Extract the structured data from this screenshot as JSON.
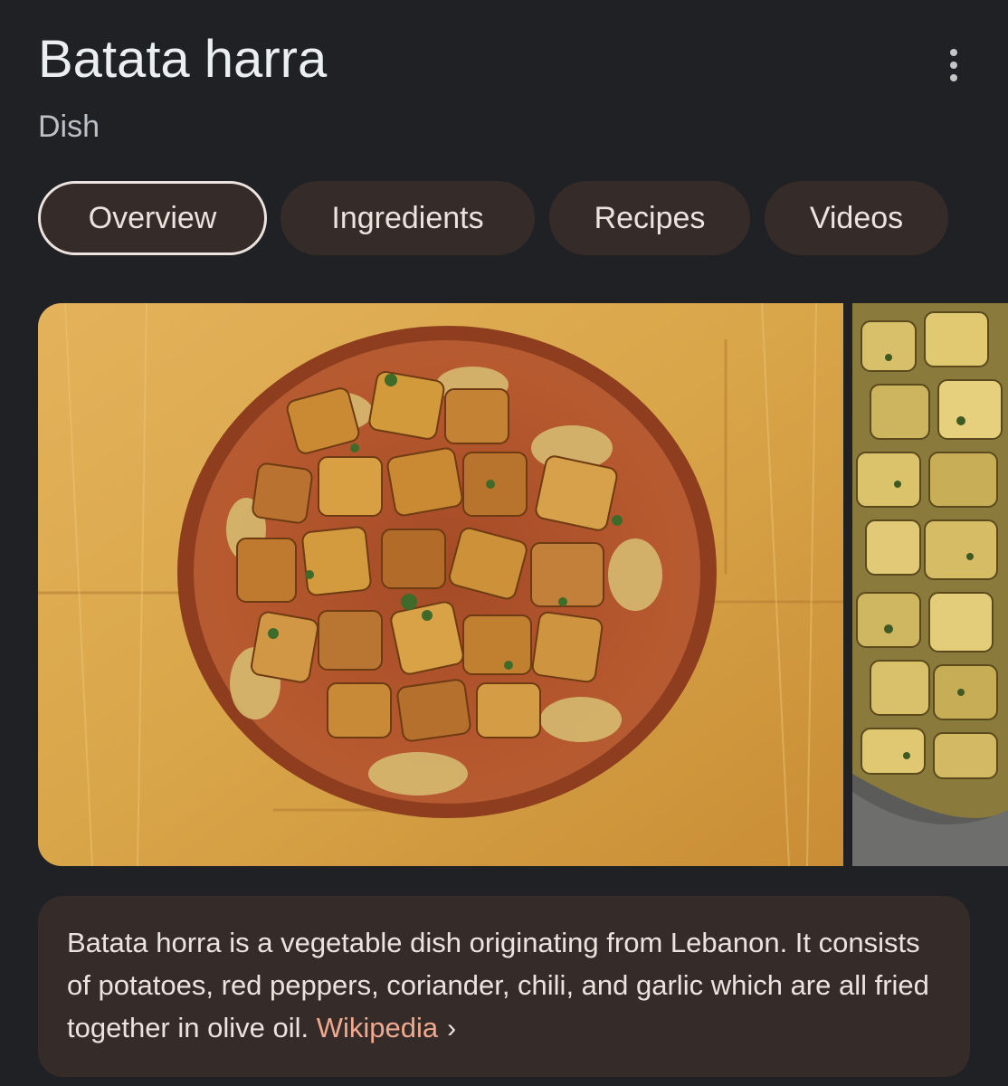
{
  "header": {
    "title": "Batata harra",
    "subtitle": "Dish",
    "more_icon": "more-vert-icon"
  },
  "tabs": [
    {
      "label": "Overview",
      "active": true
    },
    {
      "label": "Ingredients",
      "active": false
    },
    {
      "label": "Recipes",
      "active": false
    },
    {
      "label": "Videos",
      "active": false
    }
  ],
  "images": {
    "main": "potato-bowl-image",
    "secondary": "potato-pan-image"
  },
  "description": {
    "text": "Batata horra is a vegetable dish originating from Lebanon. It consists of potatoes, red peppers, coriander, chili, and garlic which are all fried together in olive oil.",
    "source_label": "Wikipedia",
    "chevron_icon": "chevron-right-icon"
  },
  "colors": {
    "background": "#202124",
    "chip": "#352c29",
    "chip_text": "#ece3df",
    "link": "#f0a98e"
  }
}
